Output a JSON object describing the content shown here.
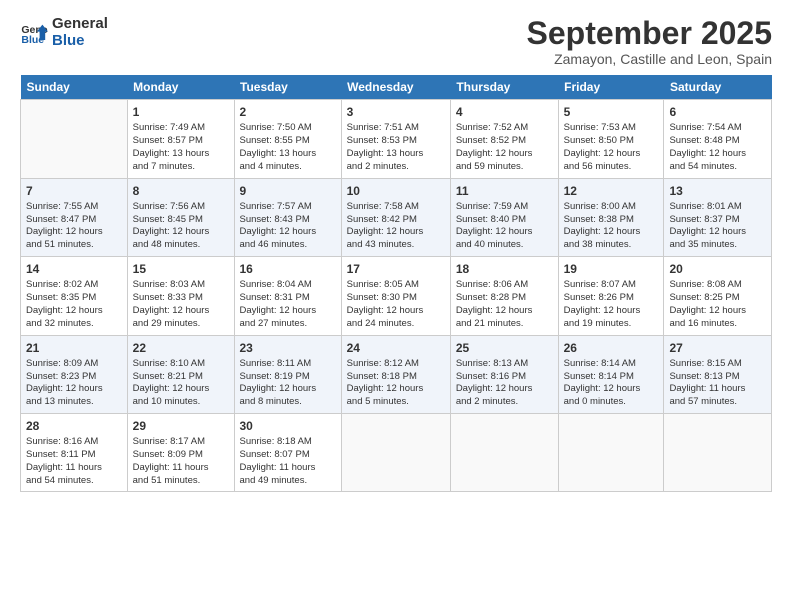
{
  "logo": {
    "line1": "General",
    "line2": "Blue"
  },
  "title": "September 2025",
  "subtitle": "Zamayon, Castille and Leon, Spain",
  "days_of_week": [
    "Sunday",
    "Monday",
    "Tuesday",
    "Wednesday",
    "Thursday",
    "Friday",
    "Saturday"
  ],
  "weeks": [
    [
      {
        "num": "",
        "info": ""
      },
      {
        "num": "1",
        "info": "Sunrise: 7:49 AM\nSunset: 8:57 PM\nDaylight: 13 hours\nand 7 minutes."
      },
      {
        "num": "2",
        "info": "Sunrise: 7:50 AM\nSunset: 8:55 PM\nDaylight: 13 hours\nand 4 minutes."
      },
      {
        "num": "3",
        "info": "Sunrise: 7:51 AM\nSunset: 8:53 PM\nDaylight: 13 hours\nand 2 minutes."
      },
      {
        "num": "4",
        "info": "Sunrise: 7:52 AM\nSunset: 8:52 PM\nDaylight: 12 hours\nand 59 minutes."
      },
      {
        "num": "5",
        "info": "Sunrise: 7:53 AM\nSunset: 8:50 PM\nDaylight: 12 hours\nand 56 minutes."
      },
      {
        "num": "6",
        "info": "Sunrise: 7:54 AM\nSunset: 8:48 PM\nDaylight: 12 hours\nand 54 minutes."
      }
    ],
    [
      {
        "num": "7",
        "info": "Sunrise: 7:55 AM\nSunset: 8:47 PM\nDaylight: 12 hours\nand 51 minutes."
      },
      {
        "num": "8",
        "info": "Sunrise: 7:56 AM\nSunset: 8:45 PM\nDaylight: 12 hours\nand 48 minutes."
      },
      {
        "num": "9",
        "info": "Sunrise: 7:57 AM\nSunset: 8:43 PM\nDaylight: 12 hours\nand 46 minutes."
      },
      {
        "num": "10",
        "info": "Sunrise: 7:58 AM\nSunset: 8:42 PM\nDaylight: 12 hours\nand 43 minutes."
      },
      {
        "num": "11",
        "info": "Sunrise: 7:59 AM\nSunset: 8:40 PM\nDaylight: 12 hours\nand 40 minutes."
      },
      {
        "num": "12",
        "info": "Sunrise: 8:00 AM\nSunset: 8:38 PM\nDaylight: 12 hours\nand 38 minutes."
      },
      {
        "num": "13",
        "info": "Sunrise: 8:01 AM\nSunset: 8:37 PM\nDaylight: 12 hours\nand 35 minutes."
      }
    ],
    [
      {
        "num": "14",
        "info": "Sunrise: 8:02 AM\nSunset: 8:35 PM\nDaylight: 12 hours\nand 32 minutes."
      },
      {
        "num": "15",
        "info": "Sunrise: 8:03 AM\nSunset: 8:33 PM\nDaylight: 12 hours\nand 29 minutes."
      },
      {
        "num": "16",
        "info": "Sunrise: 8:04 AM\nSunset: 8:31 PM\nDaylight: 12 hours\nand 27 minutes."
      },
      {
        "num": "17",
        "info": "Sunrise: 8:05 AM\nSunset: 8:30 PM\nDaylight: 12 hours\nand 24 minutes."
      },
      {
        "num": "18",
        "info": "Sunrise: 8:06 AM\nSunset: 8:28 PM\nDaylight: 12 hours\nand 21 minutes."
      },
      {
        "num": "19",
        "info": "Sunrise: 8:07 AM\nSunset: 8:26 PM\nDaylight: 12 hours\nand 19 minutes."
      },
      {
        "num": "20",
        "info": "Sunrise: 8:08 AM\nSunset: 8:25 PM\nDaylight: 12 hours\nand 16 minutes."
      }
    ],
    [
      {
        "num": "21",
        "info": "Sunrise: 8:09 AM\nSunset: 8:23 PM\nDaylight: 12 hours\nand 13 minutes."
      },
      {
        "num": "22",
        "info": "Sunrise: 8:10 AM\nSunset: 8:21 PM\nDaylight: 12 hours\nand 10 minutes."
      },
      {
        "num": "23",
        "info": "Sunrise: 8:11 AM\nSunset: 8:19 PM\nDaylight: 12 hours\nand 8 minutes."
      },
      {
        "num": "24",
        "info": "Sunrise: 8:12 AM\nSunset: 8:18 PM\nDaylight: 12 hours\nand 5 minutes."
      },
      {
        "num": "25",
        "info": "Sunrise: 8:13 AM\nSunset: 8:16 PM\nDaylight: 12 hours\nand 2 minutes."
      },
      {
        "num": "26",
        "info": "Sunrise: 8:14 AM\nSunset: 8:14 PM\nDaylight: 12 hours\nand 0 minutes."
      },
      {
        "num": "27",
        "info": "Sunrise: 8:15 AM\nSunset: 8:13 PM\nDaylight: 11 hours\nand 57 minutes."
      }
    ],
    [
      {
        "num": "28",
        "info": "Sunrise: 8:16 AM\nSunset: 8:11 PM\nDaylight: 11 hours\nand 54 minutes."
      },
      {
        "num": "29",
        "info": "Sunrise: 8:17 AM\nSunset: 8:09 PM\nDaylight: 11 hours\nand 51 minutes."
      },
      {
        "num": "30",
        "info": "Sunrise: 8:18 AM\nSunset: 8:07 PM\nDaylight: 11 hours\nand 49 minutes."
      },
      {
        "num": "",
        "info": ""
      },
      {
        "num": "",
        "info": ""
      },
      {
        "num": "",
        "info": ""
      },
      {
        "num": "",
        "info": ""
      }
    ]
  ]
}
